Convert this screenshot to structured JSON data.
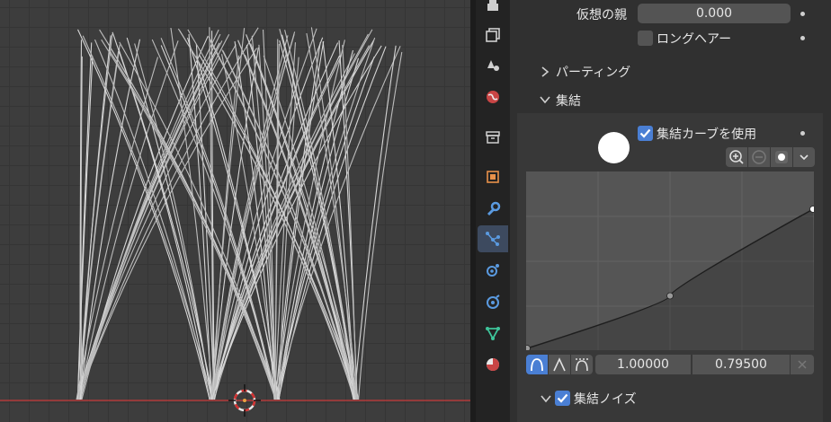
{
  "props": {
    "virtual_parents_label": "仮想の親",
    "virtual_parents_value": "0.000",
    "long_hair_label": "ロングヘアー",
    "long_hair_checked": false,
    "parting_label": "パーティング",
    "clump_label": "集結",
    "use_clump_curve_label": "集結カーブを使用",
    "use_clump_curve_checked": true,
    "clump_noise_label": "集結ノイズ",
    "clump_noise_checked": true
  },
  "curve": {
    "x_value": "1.00000",
    "y_value": "0.79500",
    "points": [
      [
        0,
        0
      ],
      [
        0.5,
        0.3
      ],
      [
        1,
        0.795
      ]
    ]
  },
  "tabs": [
    "render-icon",
    "output-icon",
    "view-layer-icon",
    "scene-icon",
    "world-icon",
    "collection-icon",
    "object-icon",
    "modifier-icon",
    "particles-icon",
    "physics-icon",
    "constraints-icon",
    "data-icon",
    "material-icon"
  ],
  "colors": {
    "accent": "#4a7fd4",
    "active_tab": "#3d4a5f",
    "axis_red": "#b23a3a"
  }
}
